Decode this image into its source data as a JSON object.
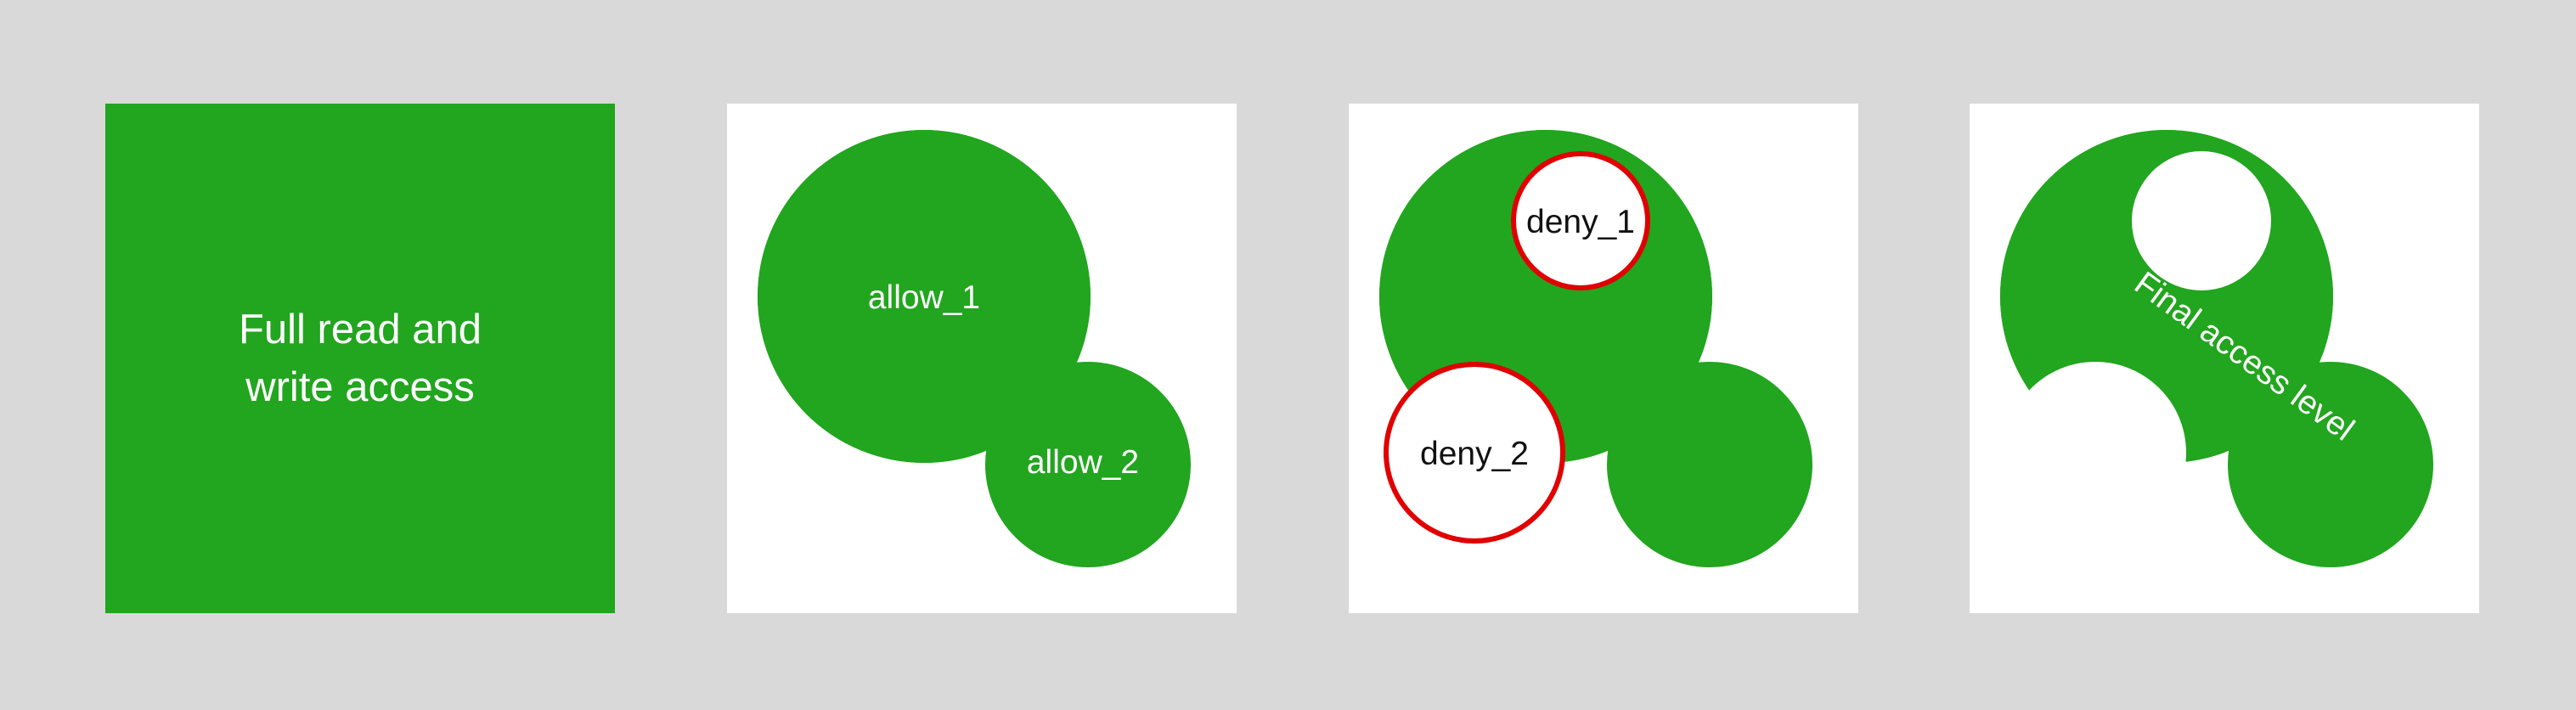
{
  "colors": {
    "background": "#d9d9d9",
    "panel": "#ffffff",
    "allow": "#22a51f",
    "deny_stroke": "#e00000"
  },
  "panels": [
    {
      "type": "full-access-square",
      "text_line_1": "Full read and",
      "text_line_2": "write access"
    },
    {
      "type": "allow-union",
      "labels": {
        "allow_1": "allow_1",
        "allow_2": "allow_2"
      }
    },
    {
      "type": "deny-overlay",
      "labels": {
        "deny_1": "deny_1",
        "deny_2": "deny_2"
      }
    },
    {
      "type": "final-result",
      "label": "Final access level"
    }
  ]
}
